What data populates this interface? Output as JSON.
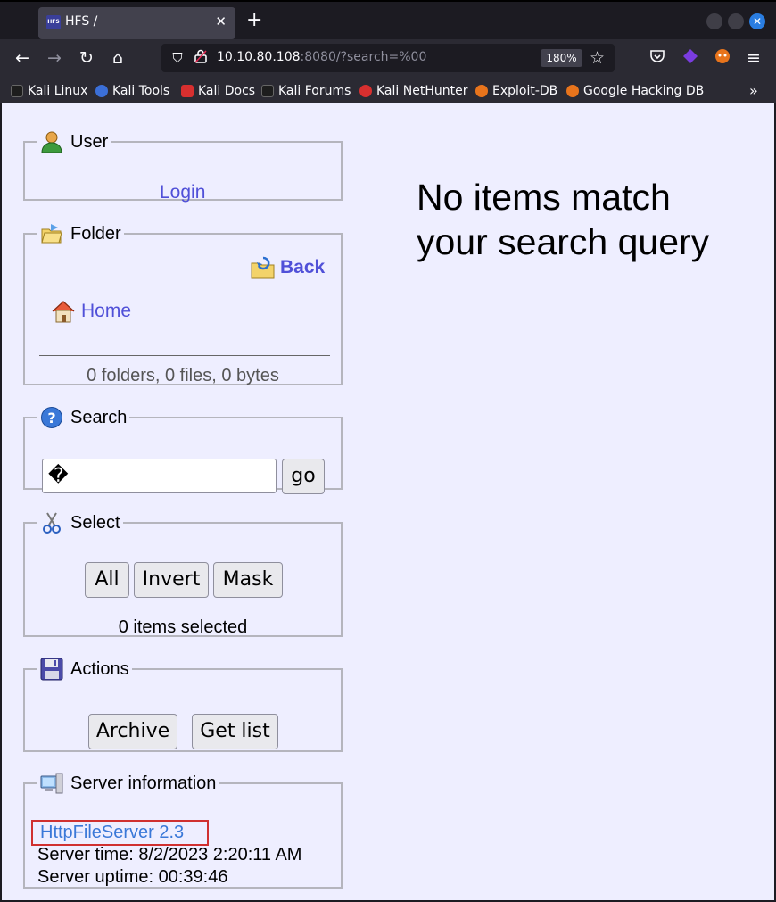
{
  "browser": {
    "tab_title": "HFS /",
    "tab_favicon_text": "HFS",
    "url_host": "10.10.80.108",
    "url_rest": ":8080/?search=%00",
    "zoom": "180%",
    "bookmarks": [
      {
        "label": "Kali Linux",
        "icon": "kali-dragon-icon",
        "color": "#1d1d1d"
      },
      {
        "label": "Kali Tools",
        "icon": "kali-tools-icon",
        "color": "#3b6fd8"
      },
      {
        "label": "Kali Docs",
        "icon": "kali-docs-icon",
        "color": "#d72f2f"
      },
      {
        "label": "Kali Forums",
        "icon": "kali-forums-icon",
        "color": "#1d1d1d"
      },
      {
        "label": "Kali NetHunter",
        "icon": "nethunter-icon",
        "color": "#d72f2f"
      },
      {
        "label": "Exploit-DB",
        "icon": "exploit-db-icon",
        "color": "#e8741c"
      },
      {
        "label": "Google Hacking DB",
        "icon": "ghdb-icon",
        "color": "#e8741c"
      }
    ]
  },
  "user": {
    "title": "User",
    "login": "Login"
  },
  "folder": {
    "title": "Folder",
    "back": "Back",
    "home": "Home",
    "summary": "0 folders, 0 files, 0 bytes"
  },
  "search": {
    "title": "Search",
    "value": "�",
    "go": "go"
  },
  "select": {
    "title": "Select",
    "all": "All",
    "invert": "Invert",
    "mask": "Mask",
    "status": "0 items selected"
  },
  "actions": {
    "title": "Actions",
    "archive": "Archive",
    "get_list": "Get list"
  },
  "server": {
    "title": "Server information",
    "version": "HttpFileServer 2.3",
    "time": "Server time: 8/2/2023 2:20:11 AM",
    "uptime": "Server uptime: 00:39:46"
  },
  "main": {
    "message": "No items match your search query"
  },
  "colors": {
    "page_background": "#eeeeff",
    "link": "#5050d8",
    "highlight_box": "#d03030"
  }
}
